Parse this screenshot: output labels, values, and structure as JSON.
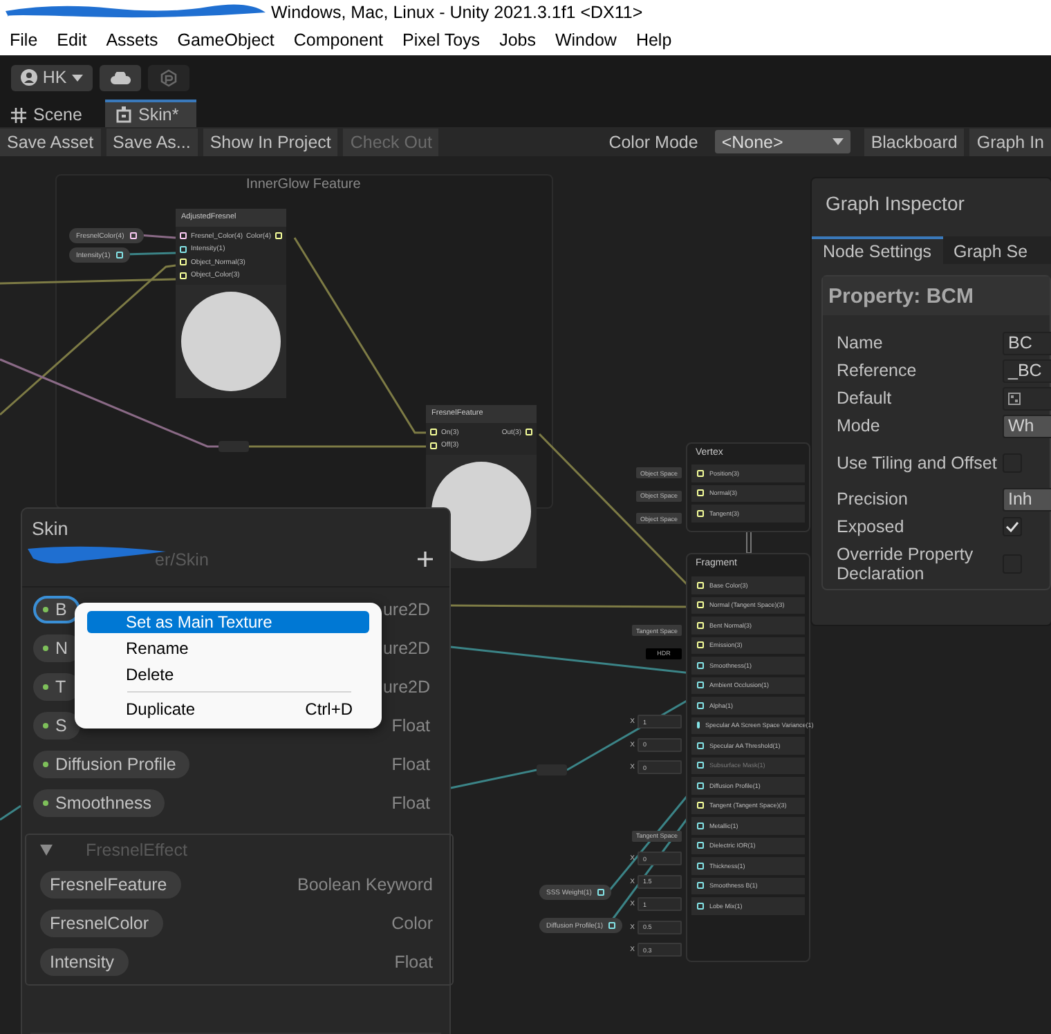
{
  "window": {
    "title": "Windows, Mac, Linux - Unity 2021.3.1f1 <DX11>"
  },
  "menu_bar": [
    "File",
    "Edit",
    "Assets",
    "GameObject",
    "Component",
    "Pixel Toys",
    "Jobs",
    "Window",
    "Help"
  ],
  "account": {
    "label": "HK"
  },
  "tabs": [
    {
      "label": "Scene",
      "selected": false
    },
    {
      "label": "Skin*",
      "selected": true
    }
  ],
  "toolbar": {
    "buttons": [
      {
        "label": "Save Asset",
        "disabled": false
      },
      {
        "label": "Save As...",
        "disabled": false
      },
      {
        "label": "Show In Project",
        "disabled": false
      },
      {
        "label": "Check Out",
        "disabled": true
      }
    ],
    "color_mode": {
      "label": "Color Mode",
      "value": "<None>"
    },
    "toggles": [
      "Blackboard",
      "Graph In"
    ]
  },
  "graph": {
    "group": {
      "title": "InnerGlow Feature"
    },
    "property_nodes": [
      {
        "label": "FresnelColor(4)",
        "color": "#fbcbf4"
      },
      {
        "label": "Intensity(1)",
        "color": "#84e4e7"
      },
      {
        "label": "SSS Weight(1)",
        "color": "#84e4e7"
      },
      {
        "label": "Diffusion Profile(1)",
        "color": "#84e4e7"
      }
    ],
    "nodes": [
      {
        "title": "AdjustedFresnel",
        "preview_expanded": true,
        "inputs": [
          {
            "label": "Fresnel_Color(4)",
            "color": "#fbcbf4"
          },
          {
            "label": "Intensity(1)",
            "color": "#84e4e7"
          },
          {
            "label": "Object_Normal(3)",
            "color": "#f6ff9a"
          },
          {
            "label": "Object_Color(3)",
            "color": "#f6ff9a"
          }
        ],
        "outputs": [
          {
            "label": "Color(4)",
            "color": "#f6ff9a"
          }
        ]
      },
      {
        "title": "FresnelFeature",
        "preview_expanded": true,
        "inputs": [
          {
            "label": "On(3)",
            "color": "#f6ff9a"
          },
          {
            "label": "Off(3)",
            "color": "#f6ff9a"
          }
        ],
        "outputs": [
          {
            "label": "Out(3)",
            "color": "#f6ff9a"
          }
        ]
      }
    ],
    "vertex": {
      "title": "Vertex",
      "slots": [
        {
          "label": "Position(3)",
          "color": "#f6ff9a",
          "disabled": false,
          "input": {
            "kind": "space",
            "value": "Object Space"
          }
        },
        {
          "label": "Normal(3)",
          "color": "#f6ff9a",
          "disabled": false,
          "input": {
            "kind": "space",
            "value": "Object Space"
          }
        },
        {
          "label": "Tangent(3)",
          "color": "#f6ff9a",
          "disabled": false,
          "input": {
            "kind": "space",
            "value": "Object Space"
          }
        }
      ]
    },
    "fragment": {
      "title": "Fragment",
      "slots": [
        {
          "label": "Base Color(3)",
          "color": "#f6ff9a",
          "disabled": false
        },
        {
          "label": "Normal (Tangent Space)(3)",
          "color": "#f6ff9a",
          "disabled": false
        },
        {
          "label": "Bent Normal(3)",
          "color": "#f6ff9a",
          "disabled": false,
          "input": {
            "kind": "space",
            "value": "Tangent Space"
          }
        },
        {
          "label": "Emission(3)",
          "color": "#f6ff9a",
          "disabled": false,
          "input": {
            "kind": "hdr",
            "value": "HDR"
          }
        },
        {
          "label": "Smoothness(1)",
          "color": "#84e4e7",
          "disabled": false
        },
        {
          "label": "Ambient Occlusion(1)",
          "color": "#84e4e7",
          "disabled": false
        },
        {
          "label": "Alpha(1)",
          "color": "#84e4e7",
          "disabled": false,
          "input": {
            "kind": "number",
            "axis": "X",
            "value": "1"
          }
        },
        {
          "label": "Specular AA Screen Space Variance(1)",
          "color": "#84e4e7",
          "disabled": false,
          "input": {
            "kind": "number",
            "axis": "X",
            "value": "0"
          }
        },
        {
          "label": "Specular AA Threshold(1)",
          "color": "#84e4e7",
          "disabled": false,
          "input": {
            "kind": "number",
            "axis": "X",
            "value": "0"
          }
        },
        {
          "label": "Subsurface Mask(1)",
          "color": "#84e4e7",
          "disabled": true
        },
        {
          "label": "Diffusion Profile(1)",
          "color": "#84e4e7",
          "disabled": false
        },
        {
          "label": "Tangent (Tangent Space)(3)",
          "color": "#f6ff9a",
          "disabled": false,
          "input": {
            "kind": "space",
            "value": "Tangent Space"
          }
        },
        {
          "label": "Metallic(1)",
          "color": "#84e4e7",
          "disabled": false,
          "input": {
            "kind": "number",
            "axis": "X",
            "value": "0"
          }
        },
        {
          "label": "Dielectric IOR(1)",
          "color": "#84e4e7",
          "disabled": false,
          "input": {
            "kind": "number",
            "axis": "X",
            "value": "1.5"
          }
        },
        {
          "label": "Thickness(1)",
          "color": "#84e4e7",
          "disabled": false,
          "input": {
            "kind": "number",
            "axis": "X",
            "value": "1"
          }
        },
        {
          "label": "Smoothness B(1)",
          "color": "#84e4e7",
          "disabled": false,
          "input": {
            "kind": "number",
            "axis": "X",
            "value": "0.5"
          }
        },
        {
          "label": "Lobe Mix(1)",
          "color": "#84e4e7",
          "disabled": false,
          "input": {
            "kind": "number",
            "axis": "X",
            "value": "0.3"
          }
        }
      ]
    }
  },
  "blackboard": {
    "title": "Skin",
    "subtitle": "er/Skin",
    "properties": [
      {
        "name": "B",
        "type": "ure2D",
        "exposed": true,
        "selected": true
      },
      {
        "name": "N",
        "type": "ure2D",
        "exposed": true,
        "selected": false
      },
      {
        "name": "T",
        "type": "ure2D",
        "exposed": true,
        "selected": false
      },
      {
        "name": "S",
        "type": "Float",
        "exposed": true,
        "selected": false
      },
      {
        "name": "Diffusion Profile",
        "type": "Float",
        "exposed": true,
        "selected": false
      },
      {
        "name": "Smoothness",
        "type": "Float",
        "exposed": true,
        "selected": false
      }
    ],
    "category": {
      "title": "FresnelEffect",
      "expanded": true,
      "properties": [
        {
          "name": "FresnelFeature",
          "type": "Boolean Keyword",
          "exposed": false,
          "selected": false
        },
        {
          "name": "FresnelColor",
          "type": "Color",
          "exposed": false,
          "selected": false
        },
        {
          "name": "Intensity",
          "type": "Float",
          "exposed": false,
          "selected": false
        }
      ]
    }
  },
  "context_menu": {
    "groups": [
      [
        {
          "label": "Set as Main Texture",
          "selected": true
        },
        {
          "label": "Rename",
          "selected": false
        },
        {
          "label": "Delete",
          "selected": false
        }
      ],
      [
        {
          "label": "Duplicate",
          "shortcut": "Ctrl+D",
          "selected": false
        }
      ]
    ]
  },
  "inspector": {
    "title": "Graph Inspector",
    "tabs": [
      {
        "label": "Node Settings",
        "selected": true
      },
      {
        "label": "Graph Se",
        "selected": false
      }
    ],
    "header": "Property: BCM",
    "fields": [
      {
        "label": "Name",
        "kind": "text",
        "value": "BC"
      },
      {
        "label": "Reference",
        "kind": "text",
        "value": "_BC"
      },
      {
        "label": "Default",
        "kind": "texture"
      },
      {
        "label": "Mode",
        "kind": "dropdown",
        "value": "Wh"
      },
      {
        "label": "Use Tiling and Offset",
        "kind": "checkbox",
        "checked": false
      },
      {
        "label": "Precision",
        "kind": "dropdown",
        "value": "Inh"
      },
      {
        "label": "Exposed",
        "kind": "checkbox",
        "checked": true
      },
      {
        "label": "Override Property Declaration",
        "kind": "checkbox",
        "checked": false
      }
    ]
  }
}
